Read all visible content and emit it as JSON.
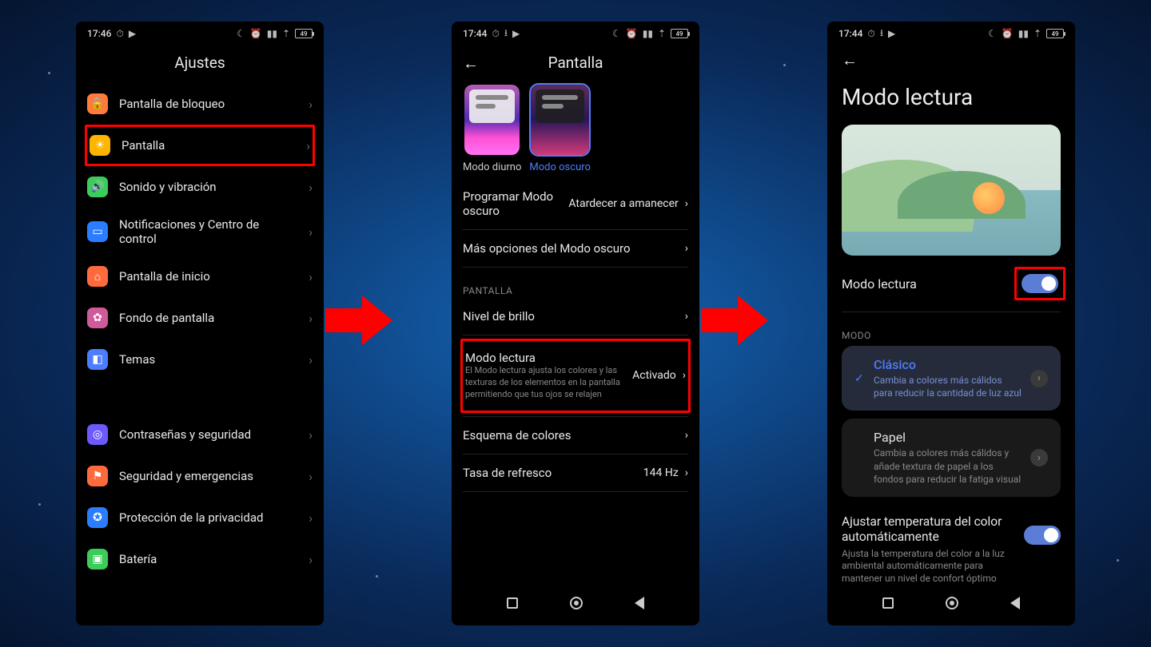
{
  "statusbar": {
    "time1": "17:46",
    "time23": "17:44",
    "battery": "49"
  },
  "phone1": {
    "title": "Ajustes",
    "items": [
      {
        "label": "Pantalla de bloqueo",
        "icon_color": "#ff7a3d",
        "glyph": "🔒"
      },
      {
        "label": "Pantalla",
        "icon_color": "#ffb400",
        "glyph": "☀",
        "highlighted": true
      },
      {
        "label": "Sonido y vibración",
        "icon_color": "#3bcc5a",
        "glyph": "🔊"
      },
      {
        "label": "Notificaciones y Centro de control",
        "icon_color": "#2a7dff",
        "glyph": "▭"
      },
      {
        "label": "Pantalla de inicio",
        "icon_color": "#ff6a3d",
        "glyph": "⌂"
      },
      {
        "label": "Fondo de pantalla",
        "icon_color": "#d15a9a",
        "glyph": "✿"
      },
      {
        "label": "Temas",
        "icon_color": "#4d7dff",
        "glyph": "◧"
      }
    ],
    "items2": [
      {
        "label": "Contraseñas y seguridad",
        "icon_color": "#6d5aff",
        "glyph": "◎"
      },
      {
        "label": "Seguridad y emergencias",
        "icon_color": "#ff6a3d",
        "glyph": "⚑"
      },
      {
        "label": "Protección de la privacidad",
        "icon_color": "#2a7dff",
        "glyph": "✪"
      },
      {
        "label": "Batería",
        "icon_color": "#3bcc5a",
        "glyph": "▣"
      }
    ]
  },
  "phone2": {
    "title": "Pantalla",
    "mode_light": "Modo diurno",
    "mode_dark": "Modo oscuro",
    "schedule_label": "Programar Modo oscuro",
    "schedule_value": "Atardecer a amanecer",
    "more_dark": "Más opciones del Modo oscuro",
    "section_screen": "PANTALLA",
    "brightness": "Nivel de brillo",
    "reading_title": "Modo lectura",
    "reading_desc": "El Modo lectura ajusta los colores y las texturas de los elementos en la pantalla permitiendo que tus ojos se relajen",
    "reading_value": "Activado",
    "color_scheme": "Esquema de colores",
    "refresh_label": "Tasa de refresco",
    "refresh_value": "144 Hz"
  },
  "phone3": {
    "title": "Modo lectura",
    "toggle_label": "Modo lectura",
    "section_mode": "MODO",
    "classic_title": "Clásico",
    "classic_desc": "Cambia a colores más cálidos para reducir la cantidad de luz azul",
    "paper_title": "Papel",
    "paper_desc": "Cambia a colores más cálidos y añade textura de papel a los fondos para reducir la fatiga visual",
    "auto_title": "Ajustar temperatura del color automáticamente",
    "auto_desc": "Ajusta la temperatura del color a la luz ambiental automáticamente para mantener un nivel de confort óptimo"
  }
}
